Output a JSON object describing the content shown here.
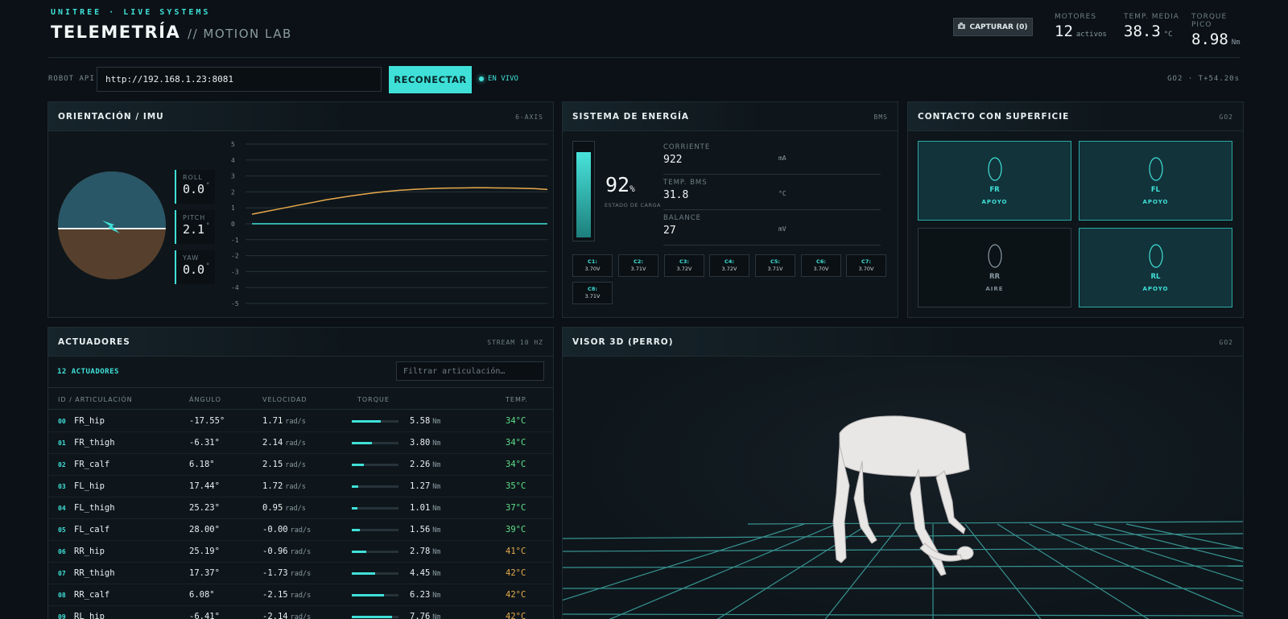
{
  "header": {
    "brand": "UNITREE · LIVE SYSTEMS",
    "title": "TELEMETRÍA",
    "subtitle": "// MOTION LAB",
    "capture_label": "CAPTURAR (0)",
    "capture_icon": "camera-icon",
    "stats": [
      {
        "label": "MOTORES",
        "value": "12",
        "unit": "activos"
      },
      {
        "label": "TEMP. MEDIA",
        "value": "38.3",
        "unit": "°C"
      },
      {
        "label": "TORQUE PICO",
        "value": "8.98",
        "unit": "Nm"
      }
    ]
  },
  "api": {
    "label": "ROBOT API",
    "url": "http://192.168.1.23:8081",
    "reconnect_label": "RECONECTAR",
    "live_label": "EN VIVO",
    "right_info": "GO2 · T+54.20s"
  },
  "imu": {
    "title": "ORIENTACIÓN / IMU",
    "tag": "6-AXIS",
    "roll": {
      "label": "ROLL",
      "value": "0.0",
      "unit": "°"
    },
    "pitch": {
      "label": "PITCH",
      "value": "2.1",
      "unit": "°"
    },
    "yaw": {
      "label": "YAW",
      "value": "0.0",
      "unit": "°"
    },
    "chart_data": {
      "type": "line",
      "yticks": [
        "5",
        "4",
        "3",
        "2",
        "1",
        "0",
        "-1",
        "-2",
        "-3",
        "-4",
        "-5"
      ],
      "ylim": [
        -5,
        5
      ],
      "series": [
        {
          "color": "#e8a94a",
          "values": [
            0.6,
            0.75,
            0.9,
            1.05,
            1.2,
            1.35,
            1.5,
            1.62,
            1.74,
            1.85,
            1.95,
            2.03,
            2.1,
            2.15,
            2.19,
            2.22,
            2.24,
            2.25,
            2.26,
            2.26,
            2.25,
            2.24,
            2.22,
            2.2,
            2.15
          ]
        },
        {
          "color": "#3fe0d8",
          "values": [
            0,
            0,
            0,
            0,
            0,
            0,
            0,
            0,
            0,
            0,
            0,
            0,
            0,
            0,
            0,
            0,
            0,
            0,
            0,
            0,
            0,
            0,
            0,
            0,
            0
          ]
        }
      ]
    }
  },
  "energy": {
    "title": "SISTEMA DE ENERGÍA",
    "tag": "BMS",
    "charge_value": "92",
    "charge_unit": "%",
    "charge_fraction": 0.92,
    "charge_label": "ESTADO DE CARGA",
    "rows": [
      {
        "label": "CORRIENTE",
        "value": "922",
        "unit": "mA"
      },
      {
        "label": "TEMP. BMS",
        "value": "31.8",
        "unit": "°C"
      },
      {
        "label": "BALANCE",
        "value": "27",
        "unit": "mV"
      }
    ],
    "cells": [
      {
        "name": "C1:",
        "value": "3.70V"
      },
      {
        "name": "C2:",
        "value": "3.71V"
      },
      {
        "name": "C3:",
        "value": "3.72V"
      },
      {
        "name": "C4:",
        "value": "3.72V"
      },
      {
        "name": "C5:",
        "value": "3.71V"
      },
      {
        "name": "C6:",
        "value": "3.70V"
      },
      {
        "name": "C7:",
        "value": "3.70V"
      },
      {
        "name": "C8:",
        "value": "3.71V"
      }
    ]
  },
  "contact": {
    "title": "CONTACTO CON SUPERFICIE",
    "tag": "GO2",
    "feet": [
      {
        "name": "FR",
        "state": "APOYO",
        "active": true
      },
      {
        "name": "FL",
        "state": "APOYO",
        "active": true
      },
      {
        "name": "RR",
        "state": "AIRE",
        "active": false
      },
      {
        "name": "RL",
        "state": "APOYO",
        "active": true
      }
    ]
  },
  "actuators": {
    "title": "ACTUADORES",
    "tag": "STREAM 10 HZ",
    "count_label": "12 ACTUADORES",
    "filter_placeholder": "Filtrar articulación…",
    "columns": [
      "ID / ARTICULACIÓN",
      "ÁNGULO",
      "VELOCIDAD",
      "TORQUE",
      "TEMP."
    ],
    "vel_unit": "rad/s",
    "torque_unit": "Nm",
    "torque_max": 8.98,
    "rows": [
      {
        "id": "00",
        "name": "FR_hip",
        "angle": "-17.55°",
        "vel": "1.71",
        "torque": "5.58",
        "torque_val": 5.58,
        "temp": "34°C",
        "temp_color": "#5fe08a"
      },
      {
        "id": "01",
        "name": "FR_thigh",
        "angle": "-6.31°",
        "vel": "2.14",
        "torque": "3.80",
        "torque_val": 3.8,
        "temp": "34°C",
        "temp_color": "#5fe08a"
      },
      {
        "id": "02",
        "name": "FR_calf",
        "angle": "6.18°",
        "vel": "2.15",
        "torque": "2.26",
        "torque_val": 2.26,
        "temp": "34°C",
        "temp_color": "#5fe08a"
      },
      {
        "id": "03",
        "name": "FL_hip",
        "angle": "17.44°",
        "vel": "1.72",
        "torque": "1.27",
        "torque_val": 1.27,
        "temp": "35°C",
        "temp_color": "#5fe08a"
      },
      {
        "id": "04",
        "name": "FL_thigh",
        "angle": "25.23°",
        "vel": "0.95",
        "torque": "1.01",
        "torque_val": 1.01,
        "temp": "37°C",
        "temp_color": "#5fe08a"
      },
      {
        "id": "05",
        "name": "FL_calf",
        "angle": "28.00°",
        "vel": "-0.00",
        "torque": "1.56",
        "torque_val": 1.56,
        "temp": "39°C",
        "temp_color": "#5fe08a"
      },
      {
        "id": "06",
        "name": "RR_hip",
        "angle": "25.19°",
        "vel": "-0.96",
        "torque": "2.78",
        "torque_val": 2.78,
        "temp": "41°C",
        "temp_color": "#e8a94a"
      },
      {
        "id": "07",
        "name": "RR_thigh",
        "angle": "17.37°",
        "vel": "-1.73",
        "torque": "4.45",
        "torque_val": 4.45,
        "temp": "42°C",
        "temp_color": "#e8a94a"
      },
      {
        "id": "08",
        "name": "RR_calf",
        "angle": "6.08°",
        "vel": "-2.15",
        "torque": "6.23",
        "torque_val": 6.23,
        "temp": "42°C",
        "temp_color": "#e8a94a"
      },
      {
        "id": "09",
        "name": "RL_hip",
        "angle": "-6.41°",
        "vel": "-2.14",
        "torque": "7.76",
        "torque_val": 7.76,
        "temp": "42°C",
        "temp_color": "#e8a94a"
      }
    ]
  },
  "viewer": {
    "title": "VISOR 3D (PERRO)",
    "tag": "GO2"
  }
}
